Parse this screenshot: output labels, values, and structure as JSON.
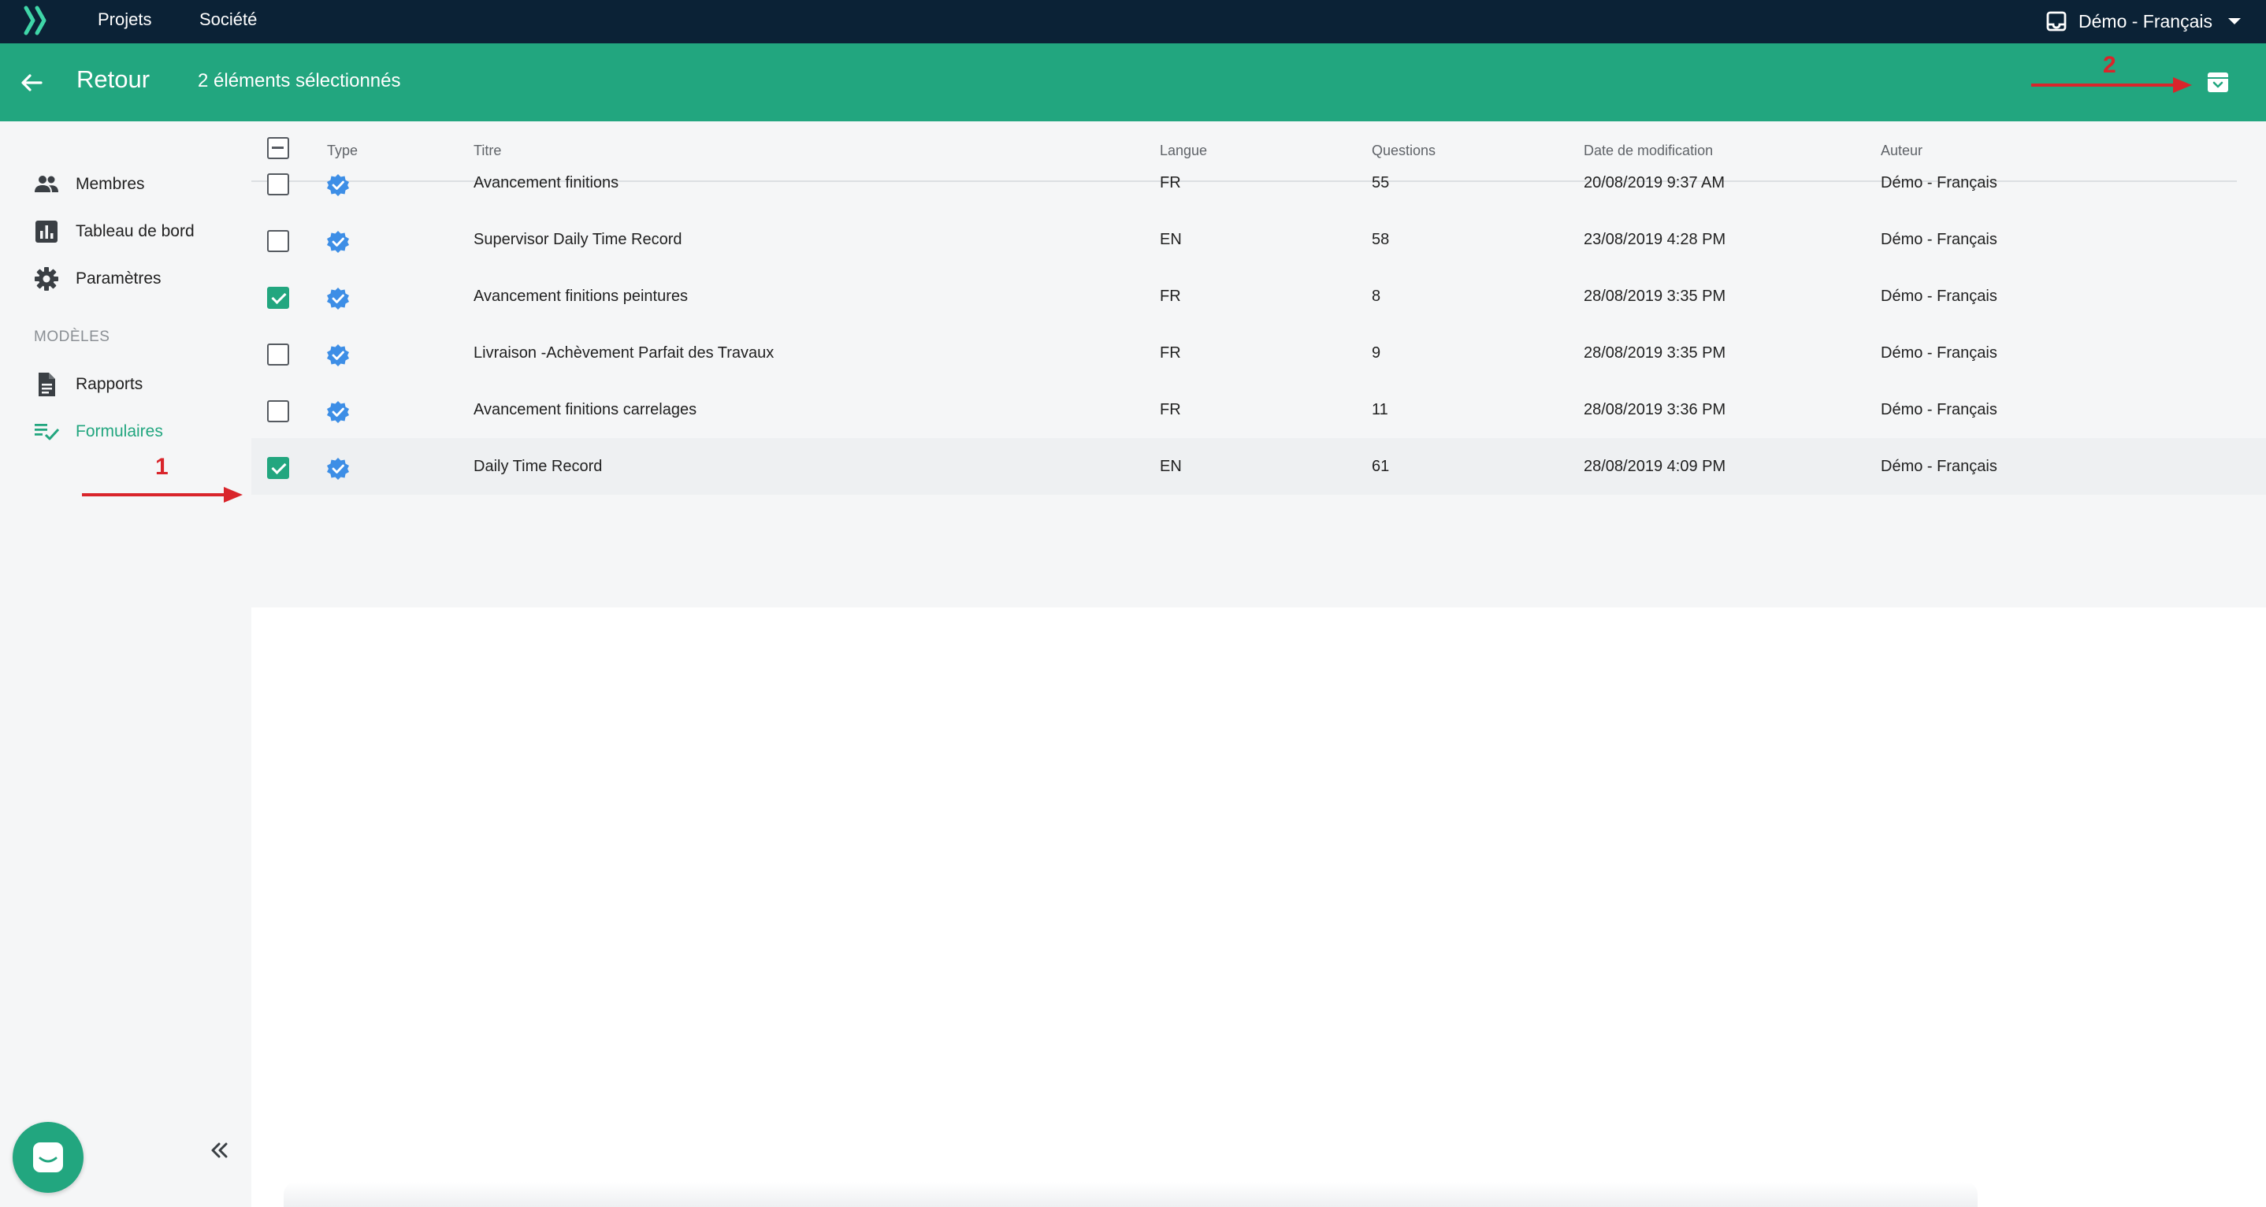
{
  "topnav": {
    "items": [
      "Projets",
      "Société"
    ],
    "org_name": "Démo - Français"
  },
  "actionbar": {
    "back_label": "Retour",
    "selection_text": "2 éléments sélectionnés"
  },
  "sidebar": {
    "items": [
      {
        "label": "Membres",
        "icon": "people-icon"
      },
      {
        "label": "Tableau de bord",
        "icon": "chart-icon"
      },
      {
        "label": "Paramètres",
        "icon": "gear-icon"
      }
    ],
    "section_label": "MODÈLES",
    "model_items": [
      {
        "label": "Rapports",
        "icon": "document-icon"
      },
      {
        "label": "Formulaires",
        "icon": "checklist-icon",
        "active": true
      }
    ]
  },
  "table": {
    "headers": [
      "Type",
      "Titre",
      "Langue",
      "Questions",
      "Date de modification",
      "Auteur"
    ],
    "rows": [
      {
        "checked": false,
        "title": "Avancement finitions",
        "lang": "FR",
        "questions": "55",
        "date": "20/08/2019 9:37 AM",
        "author": "Démo - Français"
      },
      {
        "checked": false,
        "title": "Supervisor Daily Time Record",
        "lang": "EN",
        "questions": "58",
        "date": "23/08/2019 4:28 PM",
        "author": "Démo - Français"
      },
      {
        "checked": true,
        "title": "Avancement finitions peintures",
        "lang": "FR",
        "questions": "8",
        "date": "28/08/2019 3:35 PM",
        "author": "Démo - Français"
      },
      {
        "checked": false,
        "title": "Livraison -Achèvement Parfait des Travaux",
        "lang": "FR",
        "questions": "9",
        "date": "28/08/2019 3:35 PM",
        "author": "Démo - Français"
      },
      {
        "checked": false,
        "title": "Avancement finitions carrelages",
        "lang": "FR",
        "questions": "11",
        "date": "28/08/2019 3:36 PM",
        "author": "Démo - Français"
      },
      {
        "checked": true,
        "title": "Daily Time Record",
        "lang": "EN",
        "questions": "61",
        "date": "28/08/2019 4:09 PM",
        "author": "Démo - Français"
      }
    ]
  },
  "annotations": {
    "first": "1",
    "second": "2"
  },
  "colors": {
    "topbar": "#0b2236",
    "accent": "#22a67f",
    "annotation": "#d9252b",
    "verified": "#3d8ee6"
  }
}
